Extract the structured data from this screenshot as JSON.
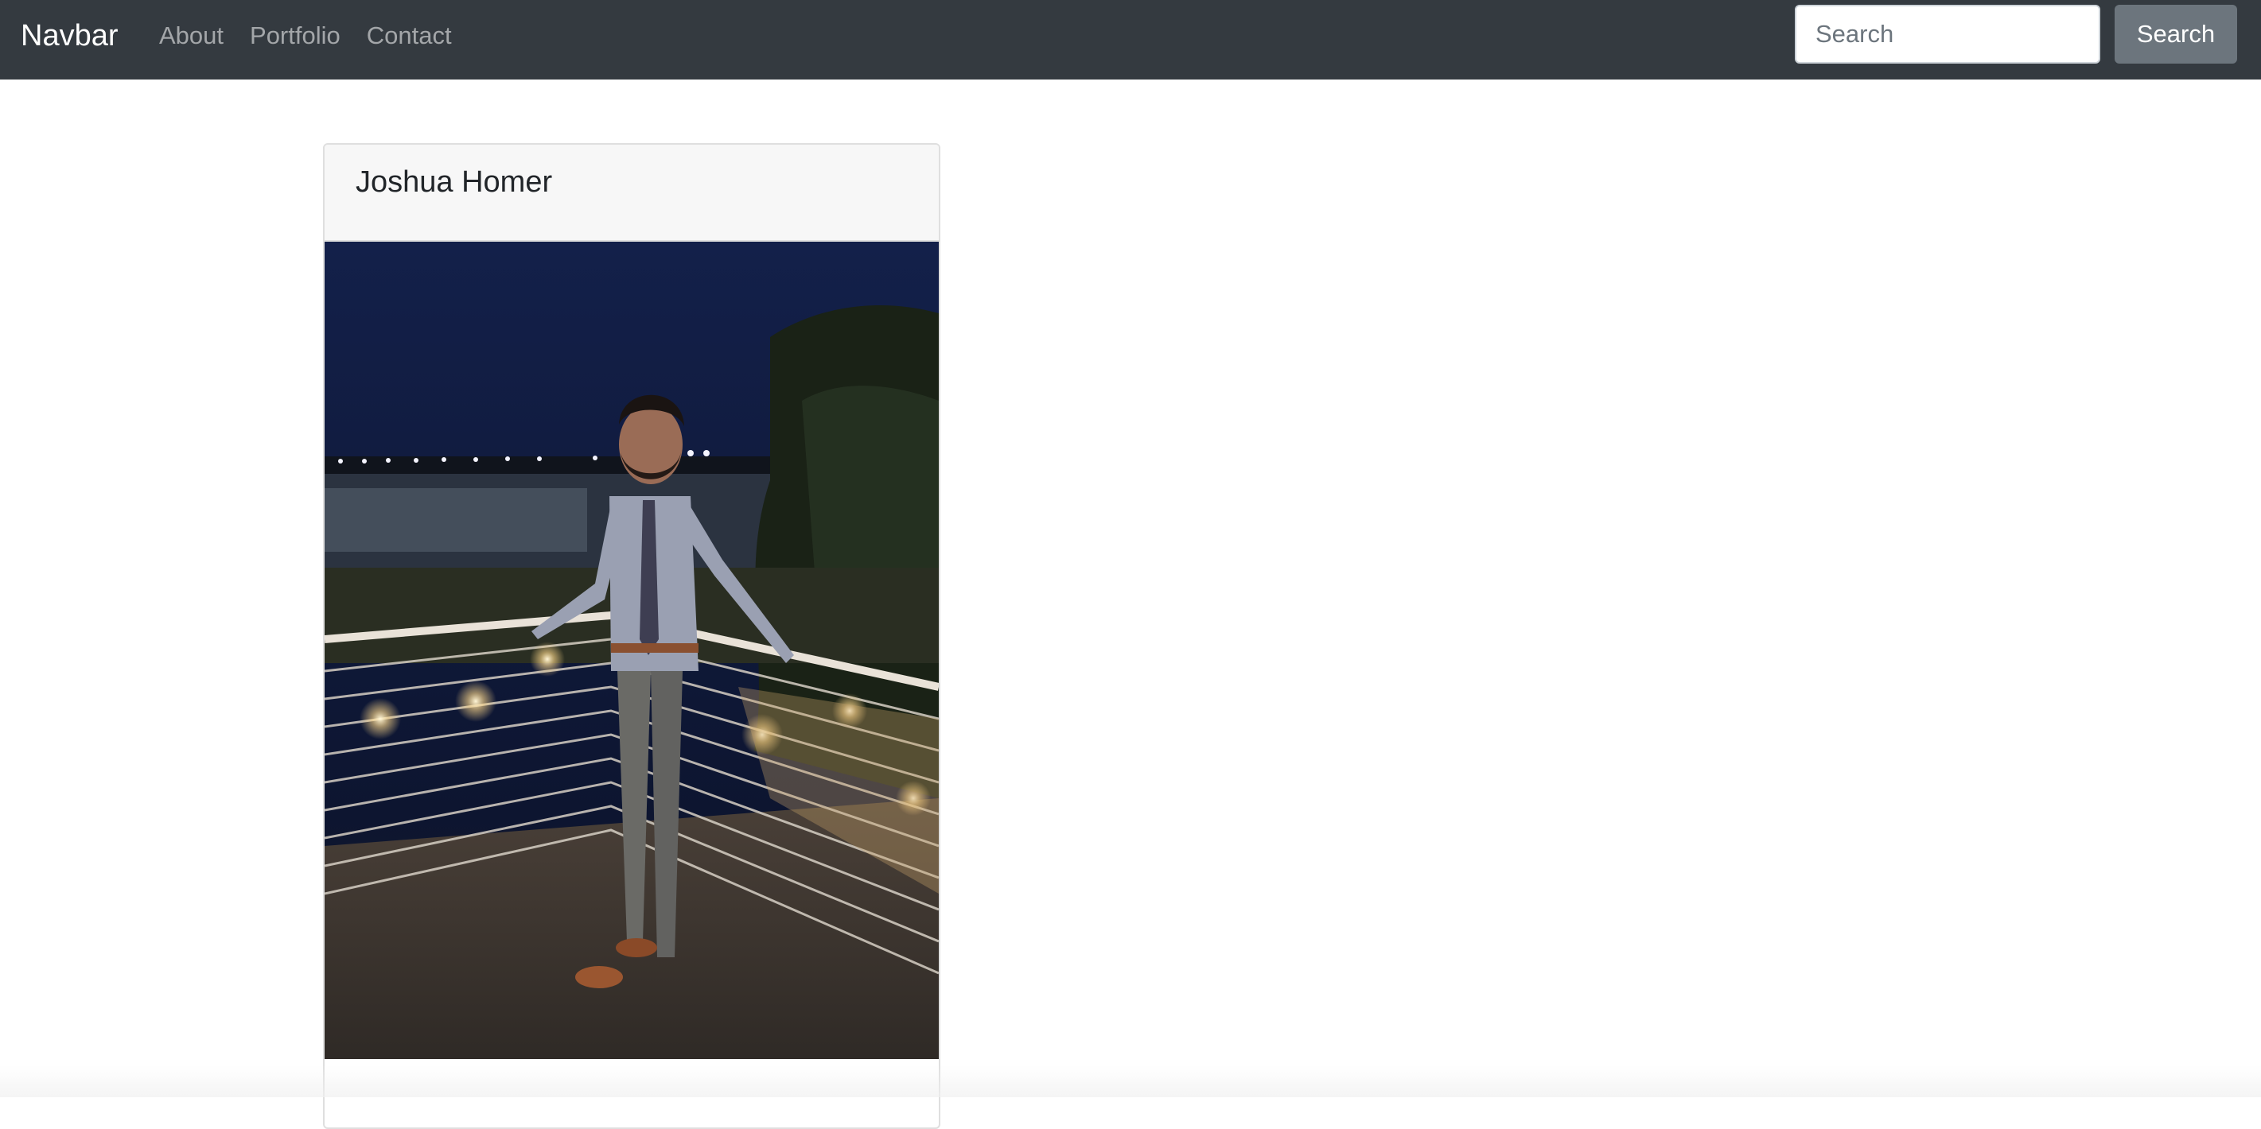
{
  "navbar": {
    "brand": "Navbar",
    "links": [
      {
        "label": "About"
      },
      {
        "label": "Portfolio"
      },
      {
        "label": "Contact"
      }
    ],
    "search": {
      "placeholder": "Search",
      "value": "",
      "button_label": "Search"
    }
  },
  "card": {
    "title": "Joshua Homer",
    "image_icon": "profile-photo"
  },
  "colors": {
    "navbar_bg": "#343a40",
    "button_bg": "#6c757d",
    "card_header_bg": "#f7f7f7"
  }
}
